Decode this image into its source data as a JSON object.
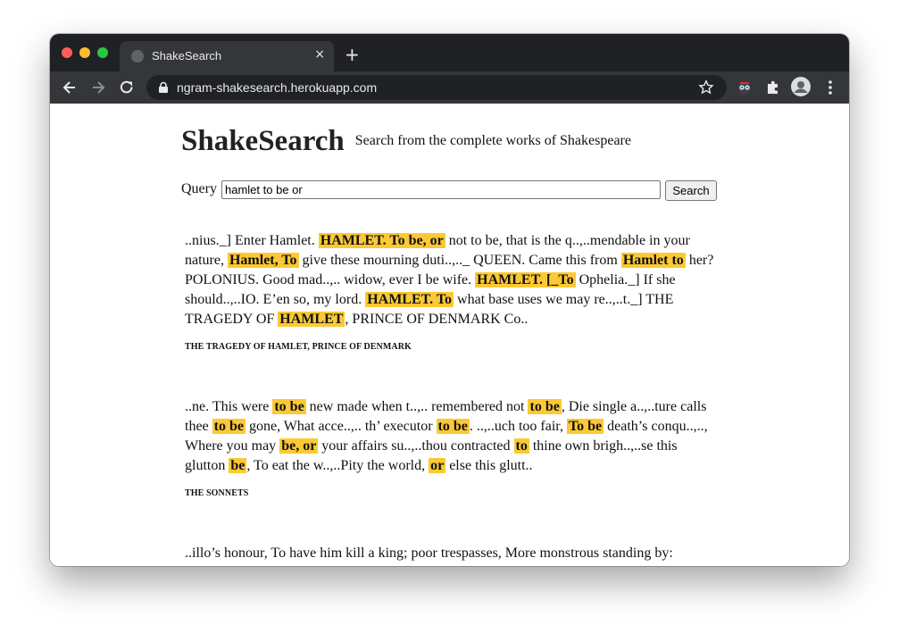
{
  "browser": {
    "tab_title": "ShakeSearch",
    "tab_close": "×",
    "new_tab": "+",
    "url": "ngram-shakesearch.herokuapp.com"
  },
  "page": {
    "title": "ShakeSearch",
    "subtitle": "Search from the complete works of Shakespeare",
    "query_label": "Query",
    "query_value": "hamlet to be or",
    "search_button": "Search"
  },
  "results": [
    {
      "segments": [
        {
          "t": "..nius._] Enter Hamlet. ",
          "h": false
        },
        {
          "t": "HAMLET. To be, or",
          "h": true
        },
        {
          "t": " not to be, that is the q..,..mendable in your nature, ",
          "h": false
        },
        {
          "t": "Hamlet, To",
          "h": true
        },
        {
          "t": " give these mourning duti..,.._ QUEEN. Came this from ",
          "h": false
        },
        {
          "t": "Hamlet to",
          "h": true
        },
        {
          "t": " her? POLONIUS. Good mad..,.. widow, ever I be wife. ",
          "h": false
        },
        {
          "t": "HAMLET. [_To",
          "h": true
        },
        {
          "t": " Ophelia._] If she should..,..IO. E’en so, my lord. ",
          "h": false
        },
        {
          "t": "HAMLET. To",
          "h": true
        },
        {
          "t": " what base uses we may re..,..t._] THE TRAGEDY OF ",
          "h": false
        },
        {
          "t": "HAMLET",
          "h": true
        },
        {
          "t": ", PRINCE OF DENMARK Co..",
          "h": false
        }
      ],
      "work": "THE TRAGEDY OF HAMLET, PRINCE OF DENMARK"
    },
    {
      "segments": [
        {
          "t": "..ne. This were ",
          "h": false
        },
        {
          "t": "to be",
          "h": true
        },
        {
          "t": " new made when t..,.. remembered not ",
          "h": false
        },
        {
          "t": "to be",
          "h": true
        },
        {
          "t": ", Die single a..,..ture calls thee ",
          "h": false
        },
        {
          "t": "to be",
          "h": true
        },
        {
          "t": " gone, What acce..,.. th’ executor ",
          "h": false
        },
        {
          "t": "to be",
          "h": true
        },
        {
          "t": ". ..,..uch too fair, ",
          "h": false
        },
        {
          "t": "To be",
          "h": true
        },
        {
          "t": " death’s conqu..,.., Where you may ",
          "h": false
        },
        {
          "t": "be, or",
          "h": true
        },
        {
          "t": " your affairs su..,..thou contracted ",
          "h": false
        },
        {
          "t": "to",
          "h": true
        },
        {
          "t": " thine own brigh..,..se this glutton ",
          "h": false
        },
        {
          "t": "be",
          "h": true
        },
        {
          "t": ", To eat the w..,..Pity the world, ",
          "h": false
        },
        {
          "t": "or",
          "h": true
        },
        {
          "t": " else this glutt..",
          "h": false
        }
      ],
      "work": "THE SONNETS"
    },
    {
      "segments": [
        {
          "t": "..illo’s honour, To have him kill a king; poor trespasses, More monstrous standing by:",
          "h": false
        }
      ],
      "work": ""
    }
  ],
  "colors": {
    "highlight": "#fcc934",
    "titlebar": "#202124",
    "toolbar": "#35363a"
  },
  "icons": [
    "back-icon",
    "forward-icon",
    "reload-icon",
    "lock-icon",
    "star-icon",
    "extension-icon",
    "puzzle-icon",
    "avatar",
    "menu-icon"
  ]
}
